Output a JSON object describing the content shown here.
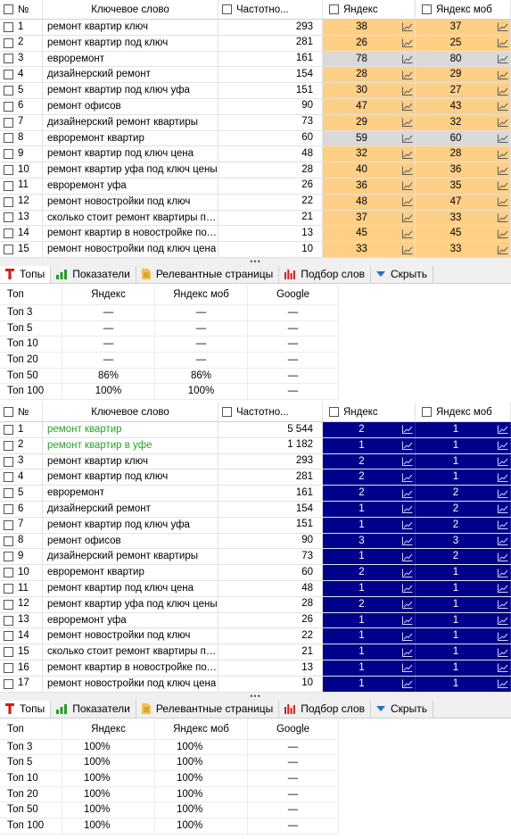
{
  "colors": {
    "orange": "#ffcf86",
    "gray": "#d9d9d9",
    "navy": "#00008b",
    "green": "#2aa12a"
  },
  "grid1": {
    "headers": {
      "num": "№",
      "keyword": "Ключевое слово",
      "freq": "Частотно...",
      "yandex": "Яндекс",
      "yandex_mob": "Яндекс моб"
    },
    "rows": [
      {
        "n": "1",
        "kw": "ремонт квартир ключ",
        "f": "293",
        "y": "38",
        "m": "37",
        "c": "orange"
      },
      {
        "n": "2",
        "kw": "ремонт квартир под ключ",
        "f": "281",
        "y": "26",
        "m": "25",
        "c": "orange"
      },
      {
        "n": "3",
        "kw": "евроремонт",
        "f": "161",
        "y": "78",
        "m": "80",
        "c": "gray"
      },
      {
        "n": "4",
        "kw": "дизайнерский ремонт",
        "f": "154",
        "y": "28",
        "m": "29",
        "c": "orange"
      },
      {
        "n": "5",
        "kw": "ремонт квартир под ключ уфа",
        "f": "151",
        "y": "30",
        "m": "27",
        "c": "orange"
      },
      {
        "n": "6",
        "kw": "ремонт офисов",
        "f": "90",
        "y": "47",
        "m": "43",
        "c": "orange"
      },
      {
        "n": "7",
        "kw": "дизайнерский ремонт квартиры",
        "f": "73",
        "y": "29",
        "m": "32",
        "c": "orange"
      },
      {
        "n": "8",
        "kw": "евроремонт квартир",
        "f": "60",
        "y": "59",
        "m": "60",
        "c": "gray"
      },
      {
        "n": "9",
        "kw": "ремонт квартир под ключ цена",
        "f": "48",
        "y": "32",
        "m": "28",
        "c": "orange"
      },
      {
        "n": "10",
        "kw": "ремонт квартир уфа под ключ цены",
        "f": "28",
        "y": "40",
        "m": "36",
        "c": "orange"
      },
      {
        "n": "11",
        "kw": "евроремонт уфа",
        "f": "26",
        "y": "36",
        "m": "35",
        "c": "orange"
      },
      {
        "n": "12",
        "kw": "ремонт новостройки под ключ",
        "f": "22",
        "y": "48",
        "m": "47",
        "c": "orange"
      },
      {
        "n": "13",
        "kw": "сколько стоит ремонт квартиры под к...",
        "f": "21",
        "y": "37",
        "m": "33",
        "c": "orange"
      },
      {
        "n": "14",
        "kw": "ремонт квартир в новостройке под к...",
        "f": "13",
        "y": "45",
        "m": "45",
        "c": "orange"
      },
      {
        "n": "15",
        "kw": "ремонт новостройки под ключ цена",
        "f": "10",
        "y": "33",
        "m": "33",
        "c": "orange"
      }
    ]
  },
  "grid2": {
    "headers": {
      "num": "№",
      "keyword": "Ключевое слово",
      "freq": "Частотно...",
      "yandex": "Яндекс",
      "yandex_mob": "Яндекс моб"
    },
    "rows": [
      {
        "n": "1",
        "kw": "ремонт квартир",
        "f": "5 544",
        "y": "2",
        "m": "1",
        "g": true
      },
      {
        "n": "2",
        "kw": "ремонт квартир в уфе",
        "f": "1 182",
        "y": "1",
        "m": "1",
        "g": true
      },
      {
        "n": "3",
        "kw": "ремонт квартир ключ",
        "f": "293",
        "y": "2",
        "m": "1",
        "g": false
      },
      {
        "n": "4",
        "kw": "ремонт квартир под ключ",
        "f": "281",
        "y": "2",
        "m": "1",
        "g": false
      },
      {
        "n": "5",
        "kw": "евроремонт",
        "f": "161",
        "y": "2",
        "m": "2",
        "g": false
      },
      {
        "n": "6",
        "kw": "дизайнерский ремонт",
        "f": "154",
        "y": "1",
        "m": "2",
        "g": false
      },
      {
        "n": "7",
        "kw": "ремонт квартир под ключ уфа",
        "f": "151",
        "y": "1",
        "m": "2",
        "g": false
      },
      {
        "n": "8",
        "kw": "ремонт офисов",
        "f": "90",
        "y": "3",
        "m": "3",
        "g": false
      },
      {
        "n": "9",
        "kw": "дизайнерский ремонт квартиры",
        "f": "73",
        "y": "1",
        "m": "2",
        "g": false
      },
      {
        "n": "10",
        "kw": "евроремонт квартир",
        "f": "60",
        "y": "2",
        "m": "1",
        "g": false
      },
      {
        "n": "11",
        "kw": "ремонт квартир под ключ цена",
        "f": "48",
        "y": "1",
        "m": "1",
        "g": false
      },
      {
        "n": "12",
        "kw": "ремонт квартир уфа под ключ цены",
        "f": "28",
        "y": "2",
        "m": "1",
        "g": false
      },
      {
        "n": "13",
        "kw": "евроремонт уфа",
        "f": "26",
        "y": "1",
        "m": "1",
        "g": false
      },
      {
        "n": "14",
        "kw": "ремонт новостройки под ключ",
        "f": "22",
        "y": "1",
        "m": "1",
        "g": false
      },
      {
        "n": "15",
        "kw": "сколько стоит ремонт квартиры под к...",
        "f": "21",
        "y": "1",
        "m": "1",
        "g": false
      },
      {
        "n": "16",
        "kw": "ремонт квартир в новостройке под к...",
        "f": "13",
        "y": "1",
        "m": "1",
        "g": false
      },
      {
        "n": "17",
        "kw": "ремонт новостройки под ключ цена",
        "f": "10",
        "y": "1",
        "m": "1",
        "g": false
      }
    ]
  },
  "grip": "•••",
  "tabs": {
    "tops": "Топы",
    "metrics": "Показатели",
    "relevant": "Релевантные страницы",
    "words": "Подбор слов",
    "hide": "Скрыть"
  },
  "tops1": {
    "headers": [
      "Топ",
      "Яндекс",
      "Яндекс моб",
      "Google"
    ],
    "rows": [
      [
        "Топ 3",
        "—",
        "—",
        "—"
      ],
      [
        "Топ 5",
        "—",
        "—",
        "—"
      ],
      [
        "Топ 10",
        "—",
        "—",
        "—"
      ],
      [
        "Топ 20",
        "—",
        "—",
        "—"
      ],
      [
        "Топ 50",
        "86%",
        "86%",
        "—"
      ],
      [
        "Топ 100",
        "100%",
        "100%",
        "—"
      ]
    ]
  },
  "tops2": {
    "headers": [
      "Топ",
      "Яндекс",
      "Яндекс моб",
      "Google"
    ],
    "rows": [
      [
        "Топ 3",
        "100%",
        "100%",
        "—"
      ],
      [
        "Топ 5",
        "100%",
        "100%",
        "—"
      ],
      [
        "Топ 10",
        "100%",
        "100%",
        "—"
      ],
      [
        "Топ 20",
        "100%",
        "100%",
        "—"
      ],
      [
        "Топ 50",
        "100%",
        "100%",
        "—"
      ],
      [
        "Топ 100",
        "100%",
        "100%",
        "—"
      ]
    ]
  }
}
